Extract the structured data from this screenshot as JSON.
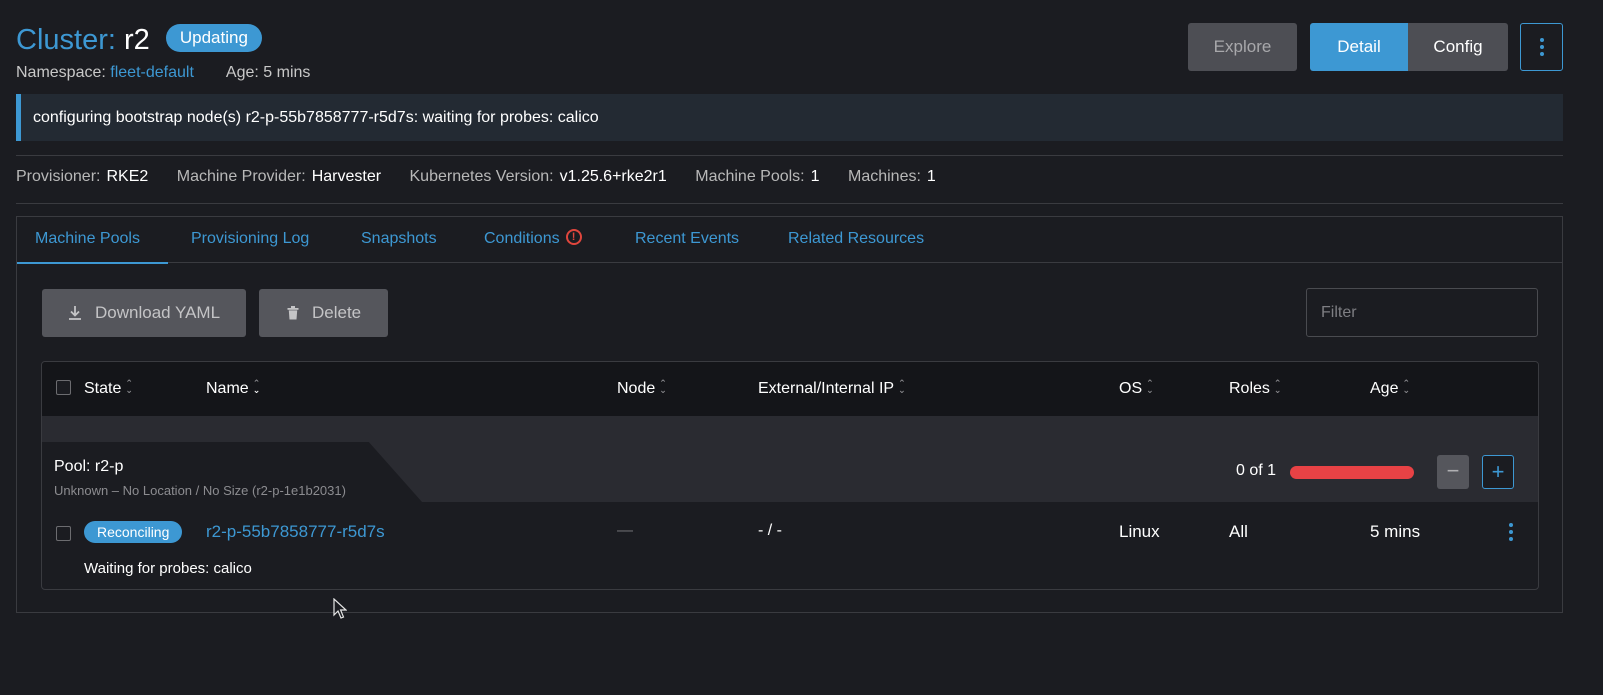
{
  "header": {
    "cluster_label": "Cluster:",
    "cluster_name": "r2",
    "status": "Updating",
    "namespace_label": "Namespace:",
    "namespace_value": "fleet-default",
    "age": "Age: 5 mins"
  },
  "actions": {
    "explore": "Explore",
    "detail": "Detail",
    "config": "Config"
  },
  "banner": {
    "message": "configuring bootstrap node(s) r2-p-55b7858777-r5d7s: waiting for probes: calico"
  },
  "specs": [
    {
      "label": "Provisioner:",
      "value": "RKE2"
    },
    {
      "label": "Machine Provider:",
      "value": "Harvester"
    },
    {
      "label": "Kubernetes Version:",
      "value": "v1.25.6+rke2r1"
    },
    {
      "label": "Machine Pools:",
      "value": "1"
    },
    {
      "label": "Machines:",
      "value": "1"
    }
  ],
  "tabs": [
    "Machine Pools",
    "Provisioning Log",
    "Snapshots",
    "Conditions",
    "Recent Events",
    "Related Resources"
  ],
  "active_tab": "Machine Pools",
  "toolbar": {
    "download_yaml": "Download YAML",
    "delete": "Delete",
    "filter_placeholder": "Filter"
  },
  "table": {
    "columns": [
      "State",
      "Name",
      "Node",
      "External/Internal IP",
      "OS",
      "Roles",
      "Age"
    ],
    "pool": {
      "name": "Pool: r2-p",
      "details": "Unknown – No Location / No Size (r2-p-1e1b2031)",
      "count": "0 of 1",
      "ready_fraction": 0
    },
    "rows": [
      {
        "state": "Reconciling",
        "name": "r2-p-55b7858777-r5d7s",
        "node": "—",
        "ip": "- / -",
        "os": "Linux",
        "roles": "All",
        "age": "5 mins",
        "message": "Waiting for probes: calico"
      }
    ]
  },
  "colors": {
    "accent": "#3d98d3",
    "background": "#1b1c21",
    "error": "#e84245"
  }
}
